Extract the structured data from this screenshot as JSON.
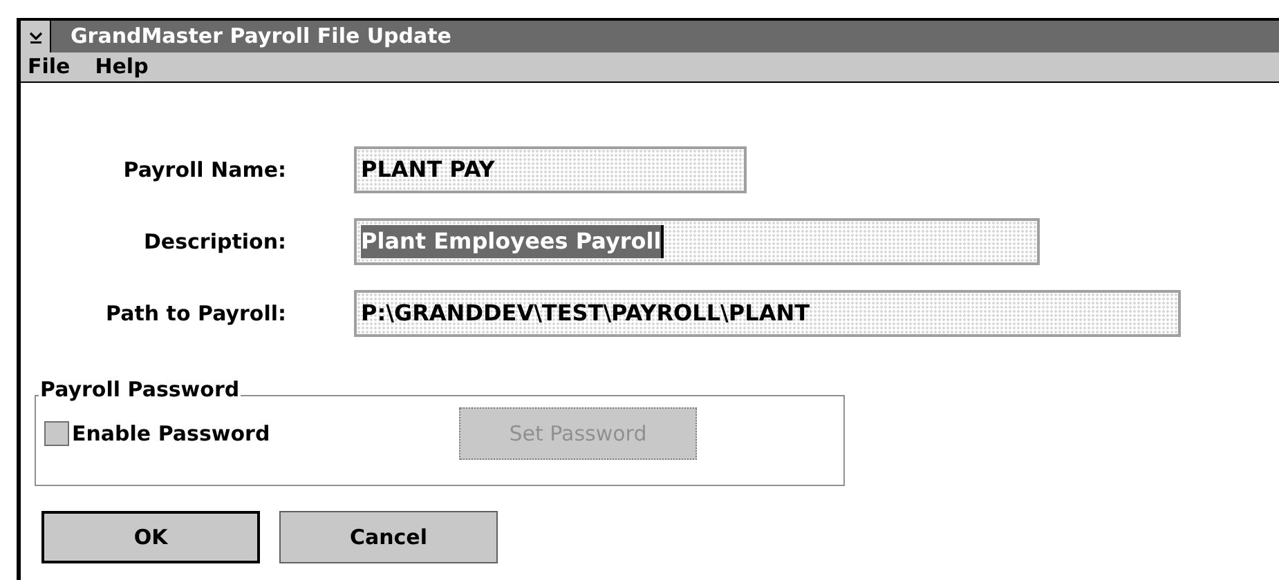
{
  "window": {
    "title": "GrandMaster Payroll File Update"
  },
  "menu": [
    "File",
    "Help"
  ],
  "fields": [
    {
      "label": "Payroll Name:",
      "value": "PLANT PAY",
      "selected": false
    },
    {
      "label": "Description:",
      "value": "Plant Employees Payroll",
      "selected": true
    },
    {
      "label": "Path to Payroll:",
      "value": "P:\\GRANDDEV\\TEST\\PAYROLL\\PLANT",
      "selected": false
    }
  ],
  "password_group": {
    "title": "Payroll Password",
    "checkbox": {
      "label": "Enable Password",
      "checked": false
    },
    "set_button": {
      "label": "Set Password",
      "disabled": true
    }
  },
  "buttons": [
    {
      "label": "OK",
      "default": true
    },
    {
      "label": "Cancel",
      "default": false
    }
  ]
}
